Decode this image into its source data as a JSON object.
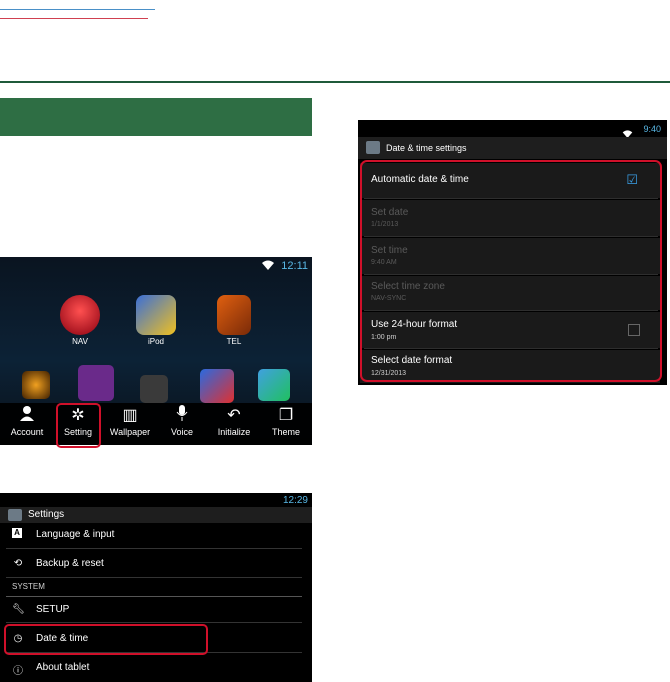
{
  "home": {
    "clock": "12:11",
    "apps": [
      {
        "label": "NAV"
      },
      {
        "label": "iPod"
      },
      {
        "label": "TEL"
      }
    ],
    "dock": [
      {
        "label": "Account",
        "icon": "person-icon"
      },
      {
        "label": "Setting",
        "icon": "gear-icon"
      },
      {
        "label": "Wallpaper",
        "icon": "wallpaper-icon"
      },
      {
        "label": "Voice",
        "icon": "microphone-icon"
      },
      {
        "label": "Initialize",
        "icon": "undo-icon"
      },
      {
        "label": "Theme",
        "icon": "theme-icon"
      }
    ]
  },
  "settings": {
    "clock": "12:29",
    "title": "Settings",
    "items": [
      {
        "label": "Language & input",
        "icon": "language-icon"
      },
      {
        "label": "Backup & reset",
        "icon": "backup-icon"
      },
      {
        "section": "SYSTEM"
      },
      {
        "label": "SETUP",
        "icon": "wrench-icon"
      },
      {
        "label": "Date & time",
        "icon": "clock-icon"
      },
      {
        "label": "About tablet",
        "icon": "info-icon"
      }
    ]
  },
  "date_time": {
    "clock": "9:40",
    "title": "Date & time settings",
    "rows": [
      {
        "title": "Automatic date & time",
        "subtitle": "",
        "enabled": true,
        "checked": true
      },
      {
        "title": "Set date",
        "subtitle": "1/1/2013",
        "enabled": false
      },
      {
        "title": "Set time",
        "subtitle": "9:40 AM",
        "enabled": false
      },
      {
        "title": "Select time zone",
        "subtitle": "NAV-SYNC",
        "enabled": false
      },
      {
        "title": "Use 24-hour format",
        "subtitle": "1:00 pm",
        "enabled": true,
        "checked": false
      },
      {
        "title": "Select date format",
        "subtitle": "12/31/2013",
        "enabled": true
      }
    ]
  },
  "colors": {
    "accent_blue": "#59b8e6",
    "highlight_red": "#d0102a",
    "header_green": "#2e6e44"
  }
}
